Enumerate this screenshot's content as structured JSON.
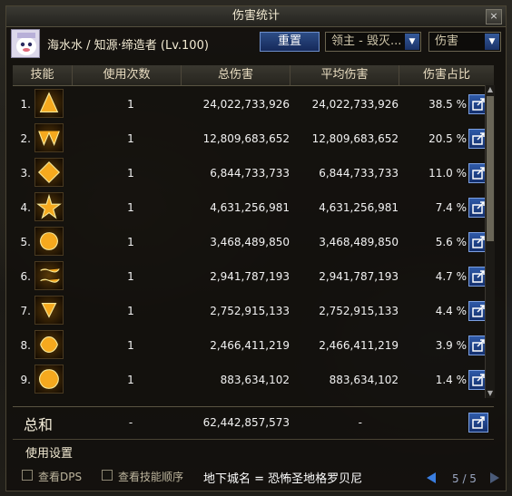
{
  "window": {
    "title": "伤害统计",
    "close_glyph": "×"
  },
  "header": {
    "character": "海水水 / 知源·缔造者 (Lv.100)",
    "reset_label": "重置",
    "boss_select": "领主 - 毁灭...",
    "metric_select": "伤害"
  },
  "columns": {
    "skill": "技能",
    "uses": "使用次数",
    "total": "总伤害",
    "avg": "平均伤害",
    "share": "伤害占比"
  },
  "rows": [
    {
      "rank": "1.",
      "uses": "1",
      "total": "24,022,733,926",
      "avg": "24,022,733,926",
      "pct": "38.5 %"
    },
    {
      "rank": "2.",
      "uses": "1",
      "total": "12,809,683,652",
      "avg": "12,809,683,652",
      "pct": "20.5 %"
    },
    {
      "rank": "3.",
      "uses": "1",
      "total": "6,844,733,733",
      "avg": "6,844,733,733",
      "pct": "11.0 %"
    },
    {
      "rank": "4.",
      "uses": "1",
      "total": "4,631,256,981",
      "avg": "4,631,256,981",
      "pct": "7.4 %"
    },
    {
      "rank": "5.",
      "uses": "1",
      "total": "3,468,489,850",
      "avg": "3,468,489,850",
      "pct": "5.6 %"
    },
    {
      "rank": "6.",
      "uses": "1",
      "total": "2,941,787,193",
      "avg": "2,941,787,193",
      "pct": "4.7 %"
    },
    {
      "rank": "7.",
      "uses": "1",
      "total": "2,752,915,133",
      "avg": "2,752,915,133",
      "pct": "4.4 %"
    },
    {
      "rank": "8.",
      "uses": "1",
      "total": "2,466,411,219",
      "avg": "2,466,411,219",
      "pct": "3.9 %"
    },
    {
      "rank": "9.",
      "uses": "1",
      "total": "883,634,102",
      "avg": "883,634,102",
      "pct": "1.4 %"
    }
  ],
  "summary": {
    "label": "总和",
    "uses": "-",
    "total": "62,442,857,573",
    "avg": "-"
  },
  "settings_label": "使用设置",
  "footer": {
    "view_dps": "查看DPS",
    "view_order": "查看技能顺序",
    "dungeon": "地下城名 = 恐怖圣地格罗贝尼",
    "page": "5 / 5"
  },
  "colors": {
    "accent": "#2f5aa8",
    "text": "#f2ead2"
  },
  "icons": [
    "skill-icon",
    "share-icon",
    "scroll-up-icon",
    "scroll-down-icon",
    "prev-page-icon",
    "next-page-icon",
    "avatar-icon"
  ]
}
